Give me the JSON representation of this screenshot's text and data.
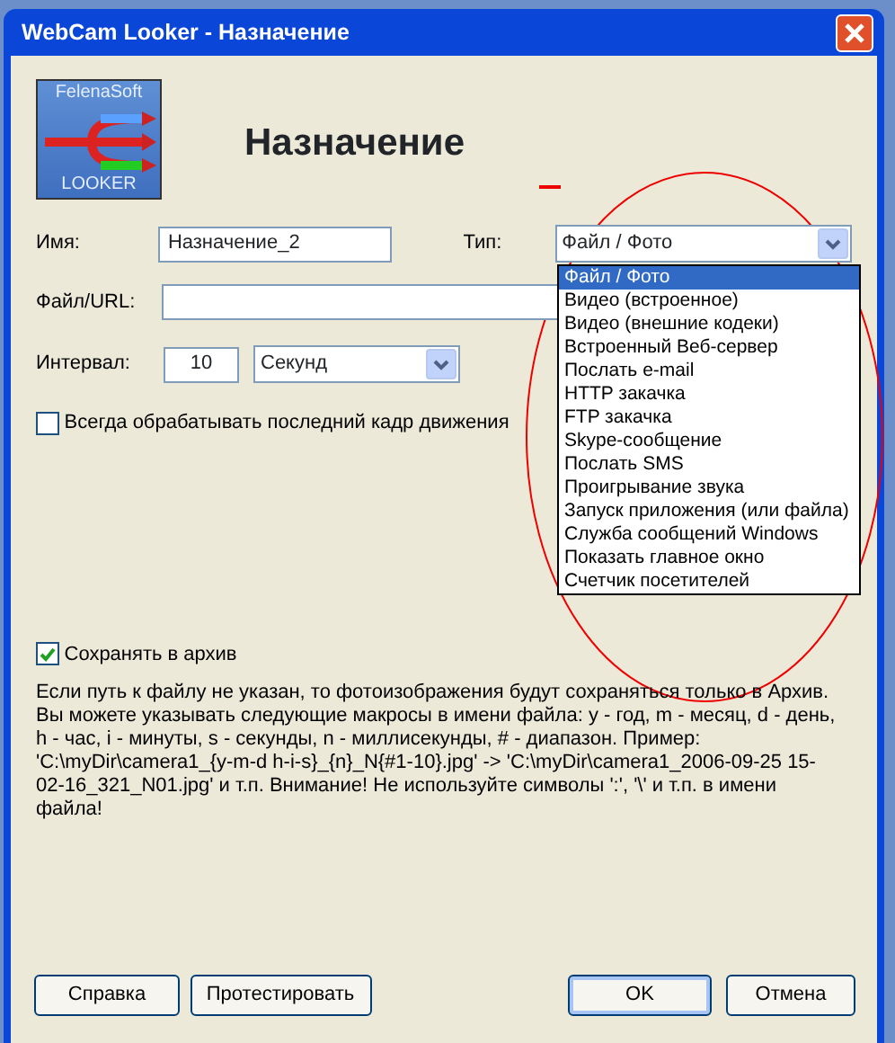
{
  "window": {
    "title": "WebCam Looker - Назначение"
  },
  "heading": "Назначение",
  "logo": {
    "top_text": "FelenaSoft",
    "bottom_text": "LOOKER"
  },
  "fields": {
    "name": {
      "label": "Имя:",
      "value": "Назначение_2"
    },
    "type": {
      "label": "Тип:",
      "value": "Файл / Фото"
    },
    "file_url": {
      "label": "Файл/URL:"
    },
    "interval": {
      "label": "Интервал:",
      "value": "10",
      "unit": "Секунд"
    }
  },
  "type_dropdown": [
    {
      "label": "Файл / Фото",
      "selected": true
    },
    {
      "label": "Видео (встроенное)",
      "selected": false
    },
    {
      "label": "Видео (внешние кодеки)",
      "selected": false
    },
    {
      "label": "Встроенный Веб-сервер",
      "selected": false
    },
    {
      "label": "Послать e-mail",
      "selected": false
    },
    {
      "label": "HTTP закачка",
      "selected": false
    },
    {
      "label": "FTP закачка",
      "selected": false
    },
    {
      "label": "Skype-сообщение",
      "selected": false
    },
    {
      "label": "Послать SMS",
      "selected": false
    },
    {
      "label": "Проигрывание звука",
      "selected": false
    },
    {
      "label": "Запуск приложения (или файла)",
      "selected": false
    },
    {
      "label": "Служба сообщений Windows",
      "selected": false
    },
    {
      "label": "Показать главное окно",
      "selected": false
    },
    {
      "label": "Счетчик посетителей",
      "selected": false
    }
  ],
  "checkboxes": [
    {
      "label": "Всегда обрабатывать последний кадр движения",
      "checked": false
    },
    {
      "label": "Сохранять в архив",
      "checked": true
    }
  ],
  "help_text": "Если путь к файлу не указан, то фотоизображения будут сохраняться только в Архив. Вы можете указывать следующие макросы в имени файла: y - год, m - месяц, d - день, h - час, i - минуты, s - секунды, n - миллисекунды, # - диапазон. Пример: 'C:\\myDir\\camera1_{y-m-d h-i-s}_{n}_N{#1-10}.jpg' -> 'C:\\myDir\\camera1_2006-09-25 15-02-16_321_N01.jpg' и т.п. Внимание! Не используйте символы ':', '\\' и т.п. в имени файла!",
  "buttons_left": [
    "Справка",
    "Протестировать"
  ],
  "buttons_right": [
    {
      "label": "OK",
      "default": true
    },
    {
      "label": "Отмена",
      "default": false
    }
  ]
}
